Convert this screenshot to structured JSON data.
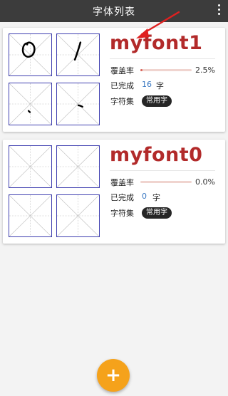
{
  "appbar": {
    "title": "字体列表",
    "menu_icon": "more-vert-icon"
  },
  "labels": {
    "coverage": "覆盖率",
    "completed": "已完成",
    "charset": "字符集",
    "count_unit": "字"
  },
  "fonts": [
    {
      "name": "myfont1",
      "coverage_text": "2.5%",
      "coverage": 0.025,
      "completed_count": "16",
      "charset": "常用字"
    },
    {
      "name": "myfont0",
      "coverage_text": "0.0%",
      "coverage": 0.0,
      "completed_count": "0",
      "charset": "常用字"
    }
  ],
  "fab": {
    "label": "+",
    "icon": "add-icon"
  },
  "colors": {
    "appbar": "#3c3c3c",
    "font_name": "#b22a2a",
    "fab": "#f5a21b",
    "grid_border": "#3f3fb0",
    "count": "#3a78c2",
    "annotation_arrow": "#e02020"
  }
}
